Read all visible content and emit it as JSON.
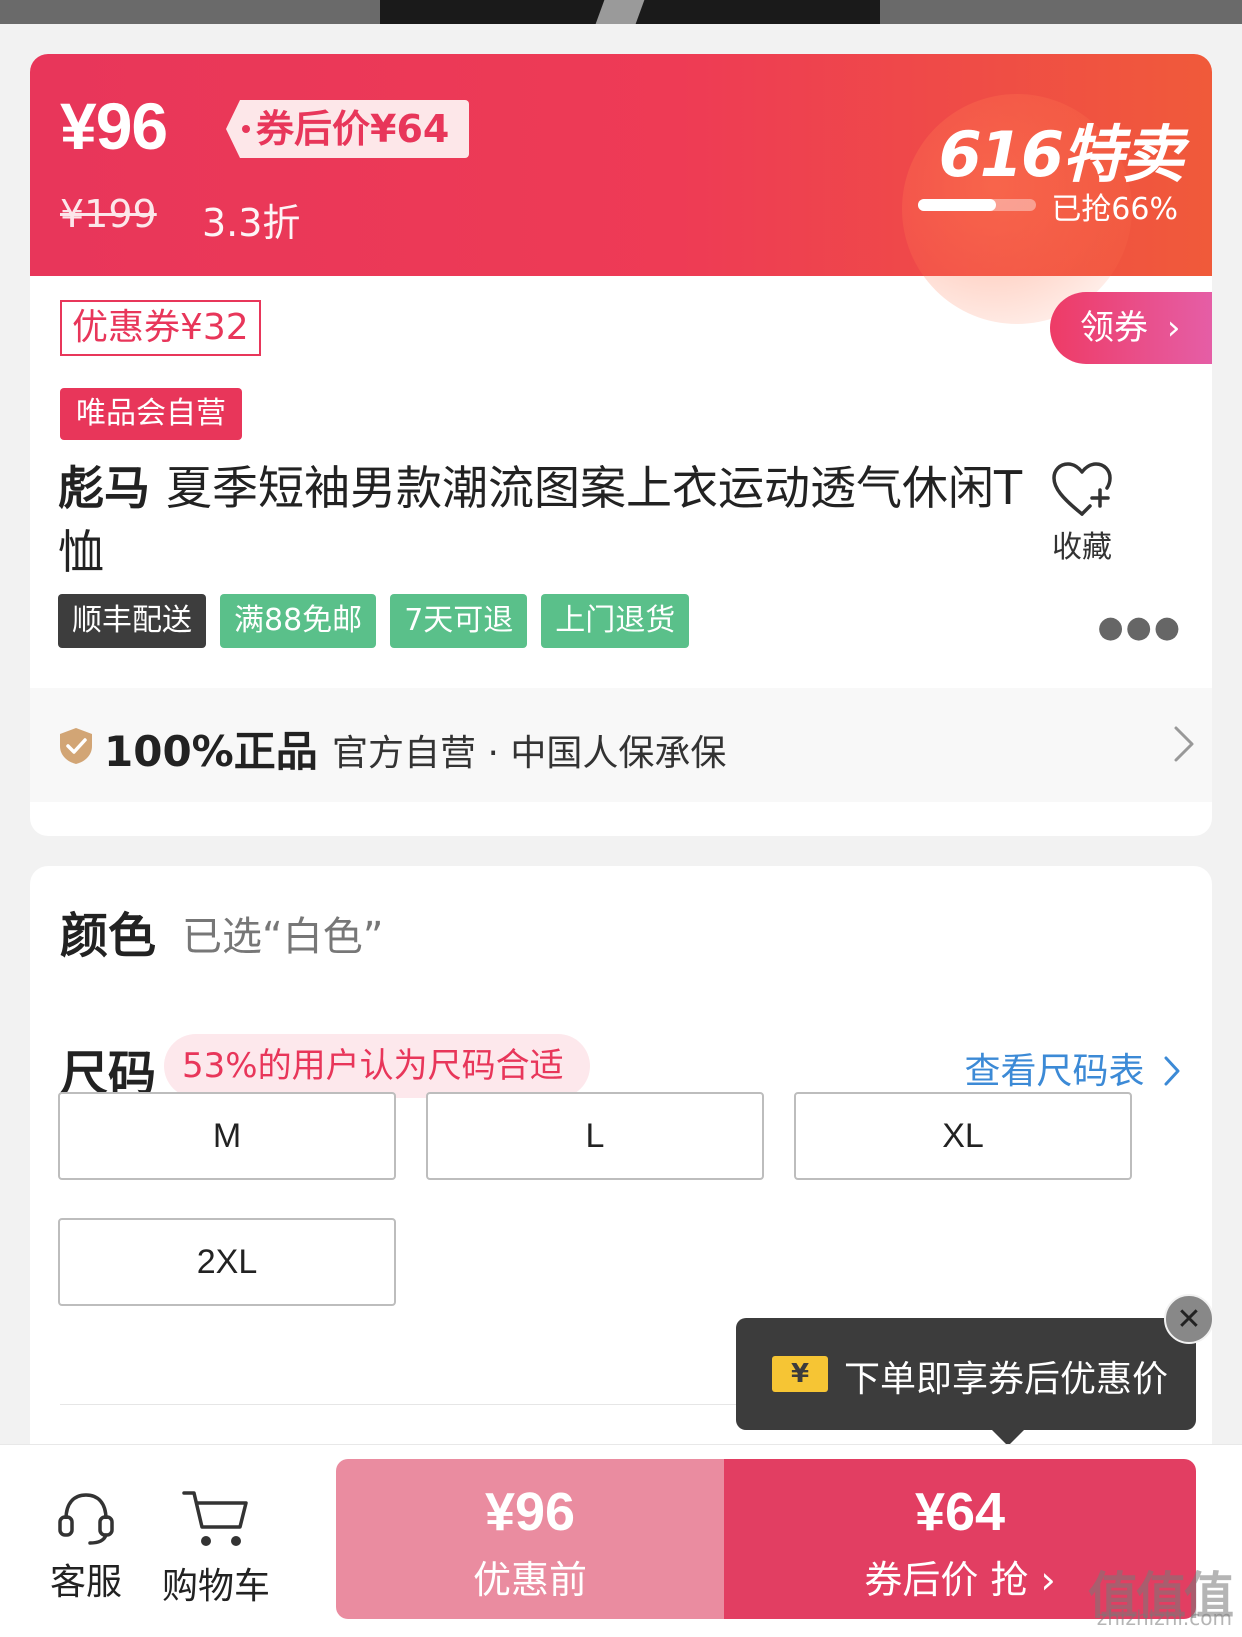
{
  "price": {
    "current": "¥96",
    "coupon_price_tag": "券后价¥64",
    "original": "¥199",
    "discount": "3.3折",
    "event_title": "616特卖",
    "sold_percent": 0.66,
    "sold_text": "已抢66%"
  },
  "coupon": {
    "label": "优惠券¥32",
    "get_button": "领券"
  },
  "product": {
    "vip_tag": "唯品会自营",
    "brand": "彪马",
    "name": "夏季短袖男款潮流图案上衣运动透气休闲T恤",
    "favorite_label": "收藏",
    "tags": [
      {
        "label": "顺丰配送",
        "style": "dark"
      },
      {
        "label": "满88免邮",
        "style": "green"
      },
      {
        "label": "7天可退",
        "style": "green"
      },
      {
        "label": "上门退货",
        "style": "green"
      }
    ]
  },
  "guarantee": {
    "bold": "100%正品",
    "text": "官方自营 · 中国人保承保"
  },
  "selection": {
    "color_label": "颜色",
    "color_value": "已选“白色”",
    "size_label": "尺码",
    "size_hint": "53%的用户认为尺码合适",
    "size_chart_link": "查看尺码表",
    "sizes": [
      "M",
      "L",
      "XL",
      "2XL"
    ]
  },
  "tooltip": {
    "icon": "¥",
    "text": "下单即享券后优惠价"
  },
  "bottom_bar": {
    "service_label": "客服",
    "cart_label": "购物车",
    "before_price": "¥96",
    "before_label": "优惠前",
    "after_price": "¥64",
    "after_label": "券后价 抢"
  },
  "watermark": {
    "text": "值值值",
    "url": "zhizhizhi.com"
  },
  "colors": {
    "accent": "#e8365a",
    "green_tag": "#5ac08a",
    "link_blue": "#3c8ad6"
  }
}
